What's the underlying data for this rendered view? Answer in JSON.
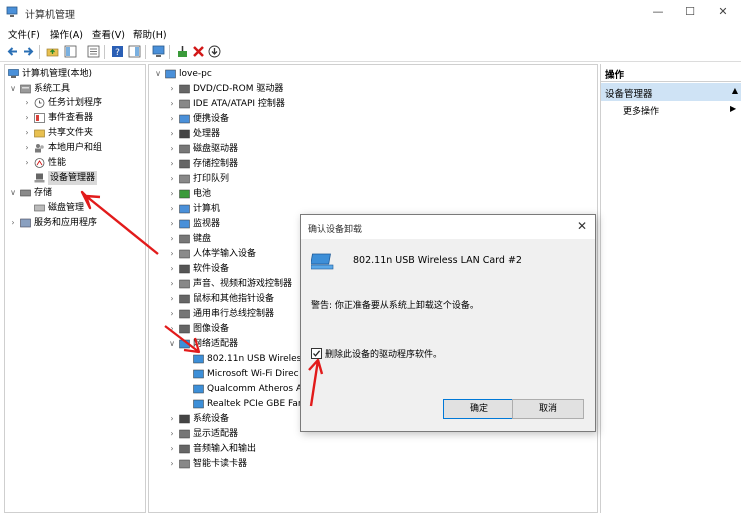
{
  "window": {
    "title": "计算机管理"
  },
  "menu": [
    "文件(F)",
    "操作(A)",
    "查看(V)",
    "帮助(H)"
  ],
  "left_tree": {
    "root": "计算机管理(本地)",
    "system_tools": "系统工具",
    "items": [
      "任务计划程序",
      "事件查看器",
      "共享文件夹",
      "本地用户和组",
      "性能",
      "设备管理器"
    ],
    "storage": "存储",
    "disk_mgmt": "磁盘管理",
    "services": "服务和应用程序"
  },
  "device_tree": {
    "root": "love-pc",
    "categories_before": [
      "DVD/CD-ROM 驱动器",
      "IDE ATA/ATAPI 控制器",
      "便携设备",
      "处理器",
      "磁盘驱动器",
      "存储控制器",
      "打印队列",
      "电池",
      "计算机",
      "监视器",
      "键盘",
      "人体学输入设备",
      "软件设备",
      "声音、视频和游戏控制器",
      "鼠标和其他指针设备",
      "通用串行总线控制器",
      "图像设备"
    ],
    "network": "网络适配器",
    "network_children": [
      "802.11n USB Wireles",
      "Microsoft Wi-Fi Direc",
      "Qualcomm Atheros A",
      "Realtek PCIe GBE Far"
    ],
    "categories_after": [
      "系统设备",
      "显示适配器",
      "音频输入和输出",
      "智能卡读卡器"
    ]
  },
  "actions": {
    "header": "操作",
    "section": "设备管理器",
    "more": "更多操作"
  },
  "dialog": {
    "title": "确认设备卸载",
    "device": "802.11n USB Wireless LAN Card #2",
    "warning": "警告: 你正准备要从系统上卸载这个设备。",
    "checkbox_label": "删除此设备的驱动程序软件。",
    "checkbox_checked": true,
    "ok": "确定",
    "cancel": "取消"
  },
  "colors": {
    "accent": "#0078d7",
    "annotation": "#e21b1b"
  }
}
